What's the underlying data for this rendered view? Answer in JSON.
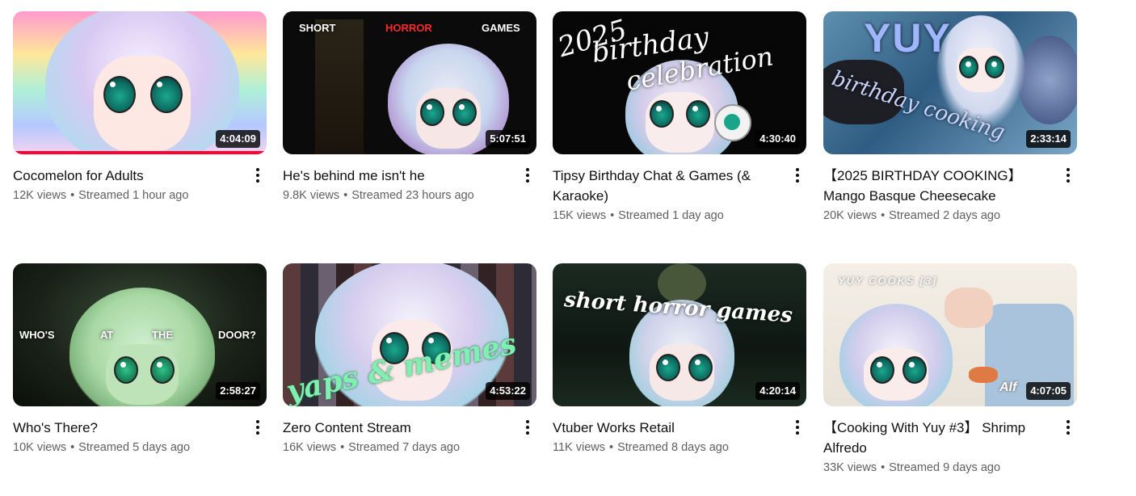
{
  "videos": [
    {
      "title": "Cocomelon for Adults",
      "views": "12K views",
      "age": "Streamed 1 hour ago",
      "duration": "4:04:09",
      "watched_fraction": 1.0,
      "overlay_text": []
    },
    {
      "title": "He's behind me isn't he",
      "views": "9.8K views",
      "age": "Streamed 23 hours ago",
      "duration": "5:07:51",
      "overlay_text": [
        "SHORT",
        "HORROR",
        "GAMES"
      ]
    },
    {
      "title": "Tipsy Birthday Chat & Games (& Karaoke)",
      "views": "15K views",
      "age": "Streamed 1 day ago",
      "duration": "4:30:40",
      "overlay_text": [
        "2025",
        "birthday",
        "celebration"
      ]
    },
    {
      "title": "【2025 BIRTHDAY COOKING】 Mango Basque Cheesecake",
      "views": "20K views",
      "age": "Streamed 2 days ago",
      "duration": "2:33:14",
      "overlay_text": [
        "YUY",
        "birthday cooking"
      ]
    },
    {
      "title": "Who's There?",
      "views": "10K views",
      "age": "Streamed 5 days ago",
      "duration": "2:58:27",
      "overlay_text": [
        "WHO'S",
        "AT",
        "THE",
        "DOOR?"
      ]
    },
    {
      "title": "Zero Content Stream",
      "views": "16K views",
      "age": "Streamed 7 days ago",
      "duration": "4:53:22",
      "overlay_text": [
        "yaps & memes"
      ]
    },
    {
      "title": "Vtuber Works Retail",
      "views": "11K views",
      "age": "Streamed 8 days ago",
      "duration": "4:20:14",
      "overlay_text": [
        "short horror games"
      ]
    },
    {
      "title": "【Cooking With Yuy #3】 Shrimp Alfredo",
      "views": "33K views",
      "age": "Streamed 9 days ago",
      "duration": "4:07:05",
      "overlay_text": [
        "YUY COOKS [3]",
        "Alf"
      ]
    }
  ],
  "separator": "•",
  "colors": {
    "progress": "#ff0033",
    "stats_text": "#606060",
    "title_text": "#0f0f0f"
  }
}
